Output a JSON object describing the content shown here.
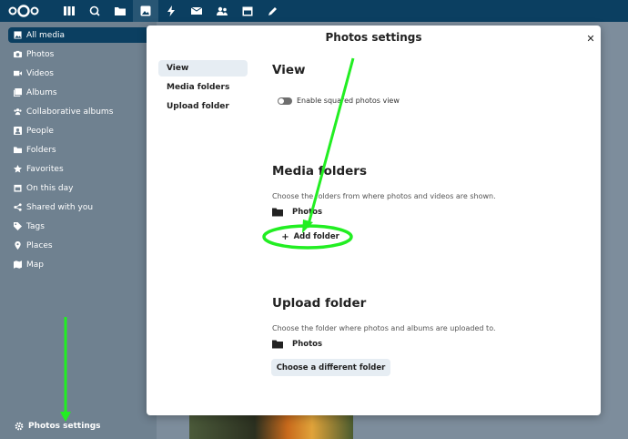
{
  "header": {
    "apps": [
      {
        "icon": "dashboard-icon"
      },
      {
        "icon": "search-icon"
      },
      {
        "icon": "files-icon"
      },
      {
        "icon": "photos-icon"
      },
      {
        "icon": "activity-icon"
      },
      {
        "icon": "mail-icon"
      },
      {
        "icon": "contacts-icon"
      },
      {
        "icon": "calendar-icon"
      },
      {
        "icon": "notes-icon"
      }
    ]
  },
  "sidebar": {
    "items": [
      {
        "label": "All media",
        "icon": "image-icon"
      },
      {
        "label": "Photos",
        "icon": "camera-icon"
      },
      {
        "label": "Videos",
        "icon": "video-icon"
      },
      {
        "label": "Albums",
        "icon": "album-icon"
      },
      {
        "label": "Collaborative albums",
        "icon": "group-icon"
      },
      {
        "label": "People",
        "icon": "people-icon"
      },
      {
        "label": "Folders",
        "icon": "folder-icon"
      },
      {
        "label": "Favorites",
        "icon": "star-icon"
      },
      {
        "label": "On this day",
        "icon": "calendar-icon"
      },
      {
        "label": "Shared with you",
        "icon": "share-icon"
      },
      {
        "label": "Tags",
        "icon": "tag-icon"
      },
      {
        "label": "Places",
        "icon": "map-pin-icon"
      },
      {
        "label": "Map",
        "icon": "map-icon"
      }
    ],
    "settings_label": "Photos settings"
  },
  "modal": {
    "title": "Photos settings",
    "close": "✕",
    "tabs": [
      {
        "label": "View"
      },
      {
        "label": "Media folders"
      },
      {
        "label": "Upload folder"
      }
    ],
    "view": {
      "title": "View",
      "toggle_label": "Enable squared photos view",
      "toggle_on": false
    },
    "media": {
      "title": "Media folders",
      "desc": "Choose the folders from where photos and videos are shown.",
      "folder": "Photos",
      "add_label": "Add folder",
      "add_plus": "+"
    },
    "upload": {
      "title": "Upload folder",
      "desc": "Choose the folder where photos and albums are uploaded to.",
      "folder": "Photos",
      "change_label": "Choose a different folder"
    }
  },
  "colors": {
    "header": "#0b3f61",
    "sidebar": "#6f8190",
    "annotation": "#22ee22",
    "tab_active": "#e6edf3"
  }
}
